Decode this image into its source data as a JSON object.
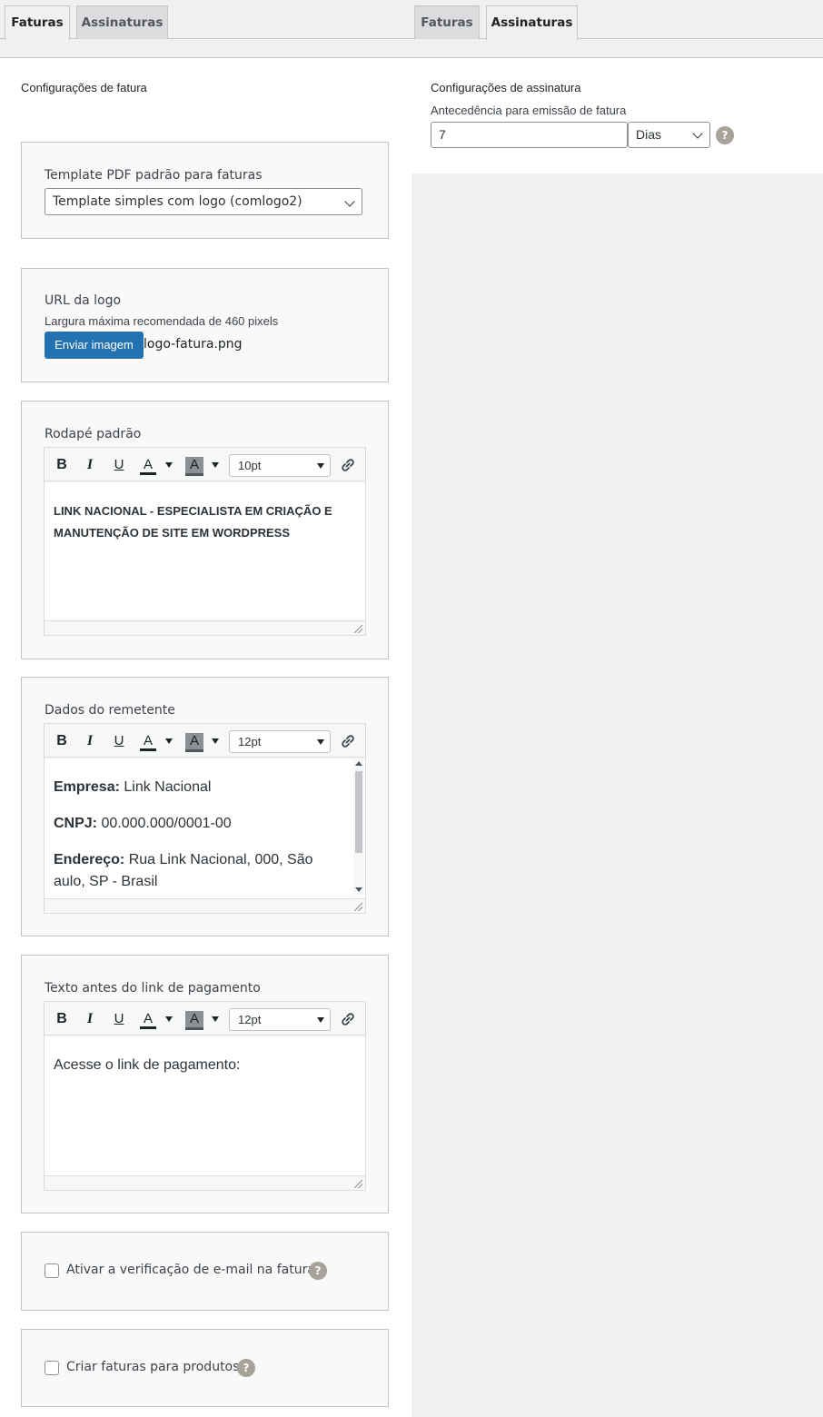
{
  "left": {
    "tabs": [
      {
        "label": "Faturas",
        "active": true
      },
      {
        "label": "Assinaturas",
        "active": false
      }
    ],
    "section_title": "Configurações de fatura",
    "template": {
      "label": "Template PDF padrão para faturas",
      "selected": "Template simples com logo (comlogo2)"
    },
    "logo": {
      "label": "URL da logo",
      "hint": "Largura máxima recomendada de 460 pixels",
      "button": "Enviar imagem",
      "filename": "logo-fatura.png"
    },
    "footer": {
      "label": "Rodapé padrão",
      "font_size": "10pt",
      "line1": "LINK NACIONAL - ESPECIALISTA EM CRIAÇÃO E",
      "line2": "MANUTENÇÃO DE SITE EM WORDPRESS"
    },
    "sender": {
      "label": "Dados do remetente",
      "font_size": "12pt",
      "company_key": "Empresa:",
      "company_val": " Link Nacional",
      "cnpj_key": "CNPJ:",
      "cnpj_val": " 00.000.000/0001-00",
      "address_key": "Endereço:",
      "address_val": " Rua Link Nacional, 000, São",
      "address_line2": "aulo, SP - Brasil"
    },
    "payment_text": {
      "label": "Texto antes do link de pagamento",
      "font_size": "12pt",
      "body": "Acesse o link de pagamento:"
    },
    "email_check": {
      "label": "Ativar a verificação de e-mail na fatura.",
      "checked": false
    },
    "products_check": {
      "label": "Criar faturas para produtos",
      "checked": false
    }
  },
  "right": {
    "tabs": [
      {
        "label": "Faturas",
        "active": false
      },
      {
        "label": "Assinaturas",
        "active": true
      }
    ],
    "section_title": "Configurações de assinatura",
    "advance": {
      "label": "Antecedência para emissão de fatura",
      "value": "7",
      "unit": "Dias"
    }
  },
  "toolbar": {
    "bold": "B",
    "italic": "I",
    "underline": "U",
    "font_color": "A",
    "bg_color": "A"
  },
  "help_glyph": "?",
  "colors": {
    "primary": "#2271b1",
    "background": "#f0f0f1",
    "help": "#a7a29a"
  }
}
